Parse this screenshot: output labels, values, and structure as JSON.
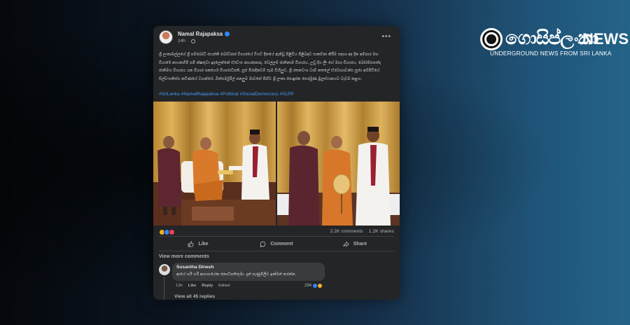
{
  "brand": {
    "name": "ගොසිප්ලංකා",
    "suffix": "NEWS",
    "tagline": "UNDERGROUND NEWS FROM SRI LANKA"
  },
  "post": {
    "author": "Namal Rajapaksa",
    "time": "14h",
    "body": "ශ්‍රී ලංකාමල්ලගේ ශ්‍රී සම්බෝධි ජයන්ති බෝධිරාජ විහාරයේ වියට් දිනයේ ඇතිවූ පිළිවිය පිළිබඳව සාකච්ඡා කිරීම සඳහා අද දින අම්පාර මහ වියාරේ නායකහිමි සමි ක්ෂතුවා ඉදලෙන්නේ ඒරවංස නායකාපාද, වෙල්ලම් ජාතිනාම විහාරය, උඩු දිය ලීං ගේ මහා විහාරය, බෝරම්සසත්ද ජාතිමහ විහාරය යන විහාර ශකයෙර් විහාරාධිපති, පූජ මිරාදිනවම් සැම විහිලුව, ශ්‍රී රතනවංශ ධාම් නතලේ ඒරවාහාවන්ස පුජ්‍ය අම්පිටියේ සිල්වංසතිස්ස නවිණයේ වහන්සේ, බිත්සර්මුරිල් පනලුම මාවතේ පිහිට ශ්‍රී ලංකා පොදුජන පෙරමුණ මූලස්ථානයට වැඩම කළහ.",
    "hashtags": "#SriLanka #NamalRajapaksa #Political #SocialDemocracy #SLPP",
    "comments_count": "2.2K comments",
    "shares_count": "1.2K shares",
    "actions": {
      "like": "Like",
      "comment": "Comment",
      "share": "Share"
    },
    "view_more_comments": "View more comments"
  },
  "comment": {
    "author": "Susantha Dinesh",
    "text": "ආයේ හරි හරි ආගාගගේක ජනාධිපතිතුමා. දැන් පැණුමිලිට ඉක්මන් කරන්න.",
    "time": "13h",
    "like": "Like",
    "reply": "Reply",
    "edited": "Edited",
    "reaction_count": "294",
    "view_replies": "View all 45 replies"
  }
}
